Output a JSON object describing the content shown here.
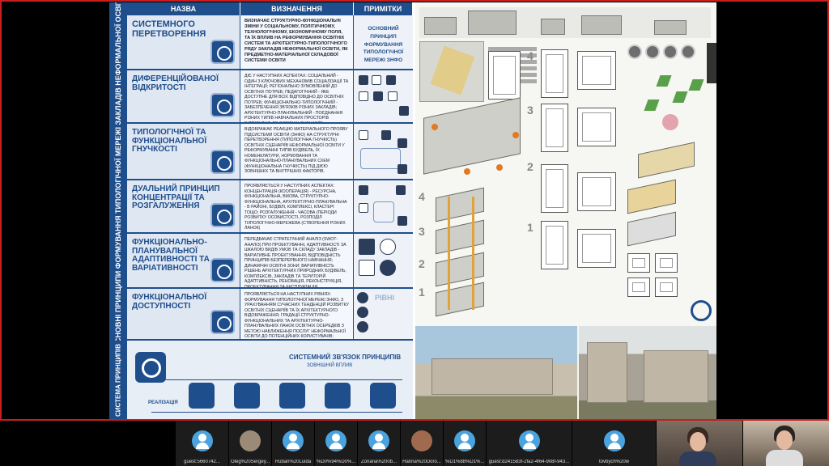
{
  "slide": {
    "side_label": "ОСНОВНІ ПРИНЦИПИ ФОРМУВАННЯ ТИПОЛОГІЧНОЇ МЕРЕЖІ ЗАКЛАДІВ НЕФОРМАЛЬНОЇ ОСВІТИ",
    "side_label_2": "СИСТЕМА ПРИНЦИПІВ",
    "headers": {
      "name": "НАЗВА",
      "definition": "ВИЗНАЧЕННЯ",
      "notes": "ПРИМІТКИ"
    },
    "rows": [
      {
        "name": "СИСТЕМНОГО ПЕРЕТВОРЕННЯ",
        "definition": "ВИЗНАЧАЄ СТРУКТУРНО-ФУНКЦІОНАЛЬНІ ЗМІНИ У СОЦІАЛЬНОМУ, ПОЛІТИЧНОМУ, ТЕХНОЛОГІЧНОМУ, ЕКОНОМІЧНОМУ ПОЛЯ, ТА ЇХ ВПЛИВ НА РЕФОРМУВАННЯ ОСВІТНІХ СИСТЕМ ТА АРХІТЕКТУРНО-ТИПОЛОГІЧНОГО РЯДУ ЗАКЛАДІВ НЕФОРМАЛЬНОЇ ОСВІТИ, ЯК ПРЕДМЕТНО-МАТЕРІАЛЬНОЇ СКЛАДОВОЇ СИСТЕМИ ОСВІТИ",
        "note": "ОСНОВНИЙ ПРИНЦИП ФОРМУВАННЯ ТИПОЛОГІЧНОЇ МЕРЕЖІ ЗНФО"
      },
      {
        "name": "ДИФЕРЕНЦІЙОВАНОЇ ВІДКРИТОСТІ",
        "definition": "ДІЄ У НАСТУПНИХ АСПЕКТАХ: СОЦІАЛЬНИЙ - ОДИН З КЛЮЧОВИХ МЕХАНІЗМІВ СОЦІАЛІЗАЦІЇ ТА ІНТЕГРАЦІЇ; РЕГІОНАЛЬНО ЗУМОВЛЕНИЙ ДО ОСВІТНІХ ПОТРЕБ; ПЕДАГОГІЧНИЙ - ЯКЕ ДОСТУПНЕ ДЛЯ ВСІХ ВІДПОВІДНО ДО ОСВІТНІХ ПОТРЕБ; ФУНКЦІОНАЛЬНО-ТИПОЛОГІЧНИЙ - ЗАБЕЗПЕЧЕННЯ ЗВ'ЯЗКІВ РІЗНИХ ЗАКЛАДІВ; АРХІТЕКТУРНО-ПЛАНУВАЛЬНИЙ - ПОЄДНАННЯ РІЗНИХ ТИПІВ НАВЧАЛЬНИХ ПРОСТОРІВ ВІДПОВІДНО ДО ОСВІТНІХ СЦЕНАРІЇВ"
      },
      {
        "name": "ТИПОЛОГІЧНОЇ ТА ФУНКЦІОНАЛЬНОЇ ГНУЧКОСТІ",
        "definition": "ВІДОБРАЖАЄ РЕАКЦІЮ МАТЕРІАЛЬНОГО ПРОЯВУ ПІДСИСТЕМИ ОСВІТИ (ЗНФО) НА СТРУКТУРНІ ПЕРЕТВОРЕННЯ (ТИПОЛОГІЧНА ГНУЧКІСТЬ) ОСВІТНІХ СЦЕНАРІЇВ НЕФОРМАЛЬНОЇ ОСВІТИ У РЕФОРМУВАННІ ТИПІВ БУДІВЕЛЬ, ЇХ НОМЕНКЛАТУРИ, НОРМУВАННЯ ТА ФУНКЦІОНАЛЬНО-ПЛАНУВАЛЬНИХ СХЕМ (ФУНКЦІОНАЛЬНА ГНУЧКІСТЬ) ПІД ДІЄЮ ЗОВНІШНІХ ТА ВНУТРІШНІХ ФАКТОРІВ."
      },
      {
        "name": "ДУАЛЬНИЙ ПРИНЦИП КОНЦЕНТРАЦІЇ ТА РОЗГАЛУЖЕННЯ",
        "definition": "ПРОЯВЛЯЄТЬСЯ У НАСТУПНИХ АСПЕКТАХ: КОНЦЕНТРАЦІЯ (КООПЕРАЦІЯ) - РЕСУРСНА, ФУНКЦІОНАЛЬНА, ВІКОВА, СТРУКТУРНО-ФУНКЦІОНАЛЬНА, АРХІТЕКТУРНО-ПЛАНУВАЛЬНА - В РАЙОНІ, БУДІВЛІ, КОМПЛЕКСІ, КЛАСТЕРІ ТОЩО; РОЗГАЛУЖЕННЯ - ЧАСОВА (ПЕРІОДИ РОЗВИТКУ ОСОБИСТОСТІ, РОЗПОДІЛ ТИПОЛОГІЧНО-МЕРЕЖЕВА (СТВОРЕННЯ РІЗНИХ ЛАНОК)"
      },
      {
        "name": "ФУНКЦІОНАЛЬНО-ПЛАНУВАЛЬНОЇ АДАПТИВНОСТІ ТА ВАРІАТИВНОСТІ",
        "definition": "ПЕРЕДБАЧАЄ СТРАТЕГІЧНИЙ АНАЛІЗ (SWOT-АНАЛІЗ) ПРИ ПРОЕКТУВАННІ, АДАПТИВНОСТІ ЗА ШКАЛОЮ ВИДІВ УМОВ ТА СКЛАДУ ЗАКЛАДІВ - ВАРІАТИВНЕ ПРОЕКТУВАННЯ; ВІДПОВІДНІСТЬ ПРИНЦИПІВ БЕЗПЕРЕРВНОГО НАВЧАННЯ; ДИНАМІЧНІ ОСВІТНІ ЗОНИ; ВАРІАТИВНІСТЬ РІШЕНЬ АРХІТЕКТУРНИХ ПРИРОДНИХ БУДІВЕЛЬ, КОМПЛЕКСІВ, ЗАКЛАДІВ ТА ТЕРИТОРІЙ АДАПТИВНІСТЬ, РЕНОВАЦІЯ, РЕКОНСТРУКЦІЯ, ПРОЕКТУВАННЯ ТА ЕКСПЛУАТАЦІЯ"
      },
      {
        "name": "ФУНКЦІОНАЛЬНОЇ ДОСТУПНОСТІ",
        "definition": "ПРОЯВЛЯЄТЬСЯ НА НАСТУПНИХ РІВНЯХ: ФОРМУВАННЯ ТИПОЛОГІЧНОЇ МЕРЕЖІ ЗНФО, З УРАХУВАННЯМ СУЧАСНИХ ТЕНДЕНЦІЙ РОЗВИТКУ ОСВІТНІХ СЦЕНАРІЇВ ТА ЇХ АРХІТЕКТУРНОГО ВІДОБРАЖЕННЯ; ГРАДАЦІЇ СТРУКТУРНО-ФУНКЦІОНАЛЬНИХ ТА АРХІТЕКТУРНО-ПЛАНУВАЛЬНИХ ЛАНОК ОСВІТНІХ ОСЕРЕДКІВ З МЕТОЮ НАБЛИЖЕННЯ ПОСЛУГ НЕФОРМАЛЬНОЇ ОСВІТИ ДО ПОТЕНЦІЙНИХ КОРИСТУВАЧІВ; ОПТИМАЛЬНЕ МІСТОБУДІВНЕ РОЗТАШУВАННЯ, ЩО ВРАХОВУЄ ПІШОХІДНУ ТА ТРАНСПОРТНУ ДОСТУПНІСТЬ ВІДПОВІДНИХ ЛАНОК",
        "note_label": "РІВНІ"
      }
    ],
    "system_title": "СИСТЕМНИЙ ЗВ'ЯЗОК ПРИНЦИПІВ",
    "system_sub": "ЗОВНІШНІЙ ВПЛИВ",
    "realization": "РЕАЛІЗАЦІЯ"
  },
  "participants": [
    {
      "name": "guest:5660742...",
      "avatar": "person-icon"
    },
    {
      "name": "Oleg%20Sergey...",
      "avatar": "photo"
    },
    {
      "name": "Ruban%20Luida",
      "avatar": "person-icon"
    },
    {
      "name": "%D0%94%D0%...",
      "avatar": "person-icon"
    },
    {
      "name": "Zoriana%200b...",
      "avatar": "person-icon"
    },
    {
      "name": "Hanna%20Doro...",
      "avatar": "photo"
    },
    {
      "name": "%D1%88%D1%...",
      "avatar": "person-icon"
    },
    {
      "name": "guest:d241583f-2fa2-4f64-908f-943...",
      "avatar": "person-icon"
    },
    {
      "name": "tovbych%20w",
      "avatar": "person-icon"
    }
  ],
  "colors": {
    "accent": "#1f4e8c",
    "frame": "#c81e1e",
    "avatar": "#4aa3df"
  }
}
